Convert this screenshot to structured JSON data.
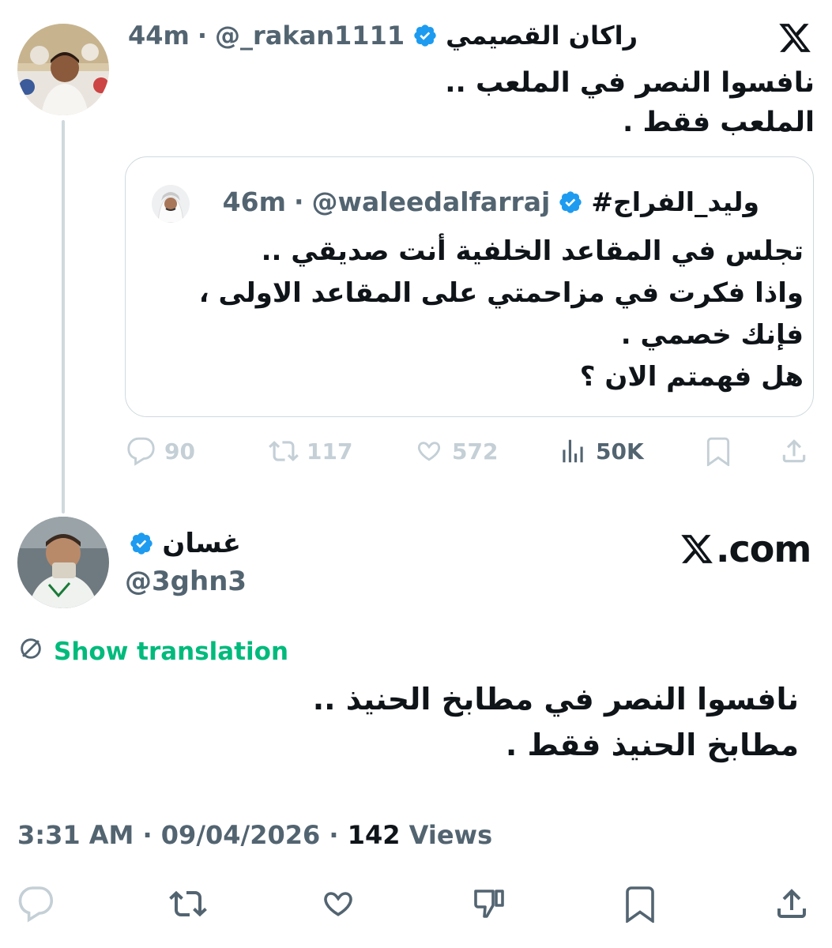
{
  "quoted_tweet": {
    "author_name": "راكان القصيمي",
    "handle": "@_rakan1111",
    "separator": "·",
    "time": "44m",
    "text": "نافسوا النصر في الملعب ..\nالملعب فقط .",
    "quote": {
      "author_name": "#وليد_الفراج",
      "handle": "@waleedalfarraj",
      "separator": "·",
      "time": "46m",
      "text": "تجلس في المقاعد الخلفية أنت صديقي ..\nواذا فكرت في مزاحمتي على المقاعد الاولى ،\nفإنك خصمي .\nهل فهمتم الان ؟"
    },
    "stats": {
      "replies": "90",
      "retweets": "117",
      "likes": "572",
      "views": "50K"
    }
  },
  "main_tweet": {
    "author_name": "غسان",
    "handle": "@3ghn3",
    "show_translation": "Show translation",
    "text": "نافسوا النصر في مطابخ الحنيذ ..\nمطابخ الحنيذ فقط .",
    "time": "3:31 AM",
    "dot": "·",
    "date": "09/04/2026",
    "views_count": "142",
    "views_label": "Views"
  },
  "watermark": {
    "site": ".com"
  },
  "colors": {
    "verified": "#1d9bf0",
    "translate": "#00ba7c",
    "muted": "#536471",
    "faded": "#c4cfd6"
  }
}
